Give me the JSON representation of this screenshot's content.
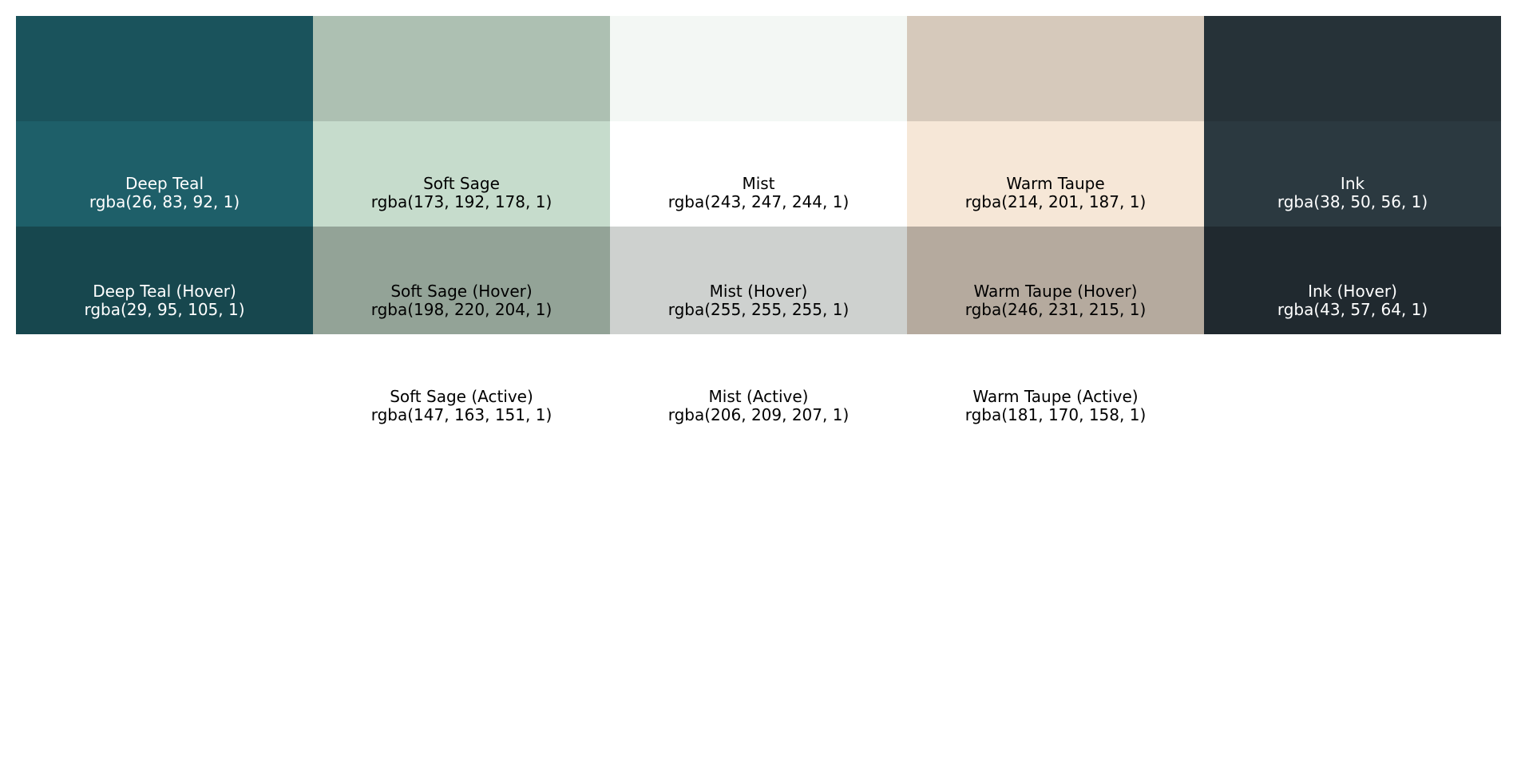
{
  "columns": [
    {
      "top_swatch_color": "#1a535c",
      "base": {
        "name": "Deep Teal",
        "rgba": "rgba(26, 83, 92, 1)",
        "color": "#1e5f69"
      },
      "hover": {
        "name": "Deep Teal (Hover)",
        "rgba": "rgba(29, 95, 105, 1)",
        "color": "#17474e"
      },
      "active": null,
      "text_color": "light"
    },
    {
      "top_swatch_color": "#adc0b2",
      "base": {
        "name": "Soft Sage",
        "rgba": "rgba(173, 192, 178, 1)",
        "color": "#c6dccc"
      },
      "hover": {
        "name": "Soft Sage (Hover)",
        "rgba": "rgba(198, 220, 204, 1)",
        "color": "#93a397"
      },
      "active": {
        "name": "Soft Sage (Active)",
        "rgba": "rgba(147, 163, 151, 1)"
      },
      "text_color": "dark"
    },
    {
      "top_swatch_color": "#f3f7f4",
      "base": {
        "name": "Mist",
        "rgba": "rgba(243, 247, 244, 1)",
        "color": "#ffffff"
      },
      "hover": {
        "name": "Mist (Hover)",
        "rgba": "rgba(255, 255, 255, 1)",
        "color": "#ced1cf"
      },
      "active": {
        "name": "Mist (Active)",
        "rgba": "rgba(206, 209, 207, 1)"
      },
      "text_color": "dark"
    },
    {
      "top_swatch_color": "#d6c9bb",
      "base": {
        "name": "Warm Taupe",
        "rgba": "rgba(214, 201, 187, 1)",
        "color": "#f6e7d7"
      },
      "hover": {
        "name": "Warm Taupe (Hover)",
        "rgba": "rgba(246, 231, 215, 1)",
        "color": "#b5aa9e"
      },
      "active": {
        "name": "Warm Taupe (Active)",
        "rgba": "rgba(181, 170, 158, 1)"
      },
      "text_color": "dark"
    },
    {
      "top_swatch_color": "#263238",
      "base": {
        "name": "Ink",
        "rgba": "rgba(38, 50, 56, 1)",
        "color": "#2b3940"
      },
      "hover": {
        "name": "Ink (Hover)",
        "rgba": "rgba(43, 57, 64, 1)",
        "color": "#20292f"
      },
      "active": null,
      "text_color": "light"
    }
  ]
}
